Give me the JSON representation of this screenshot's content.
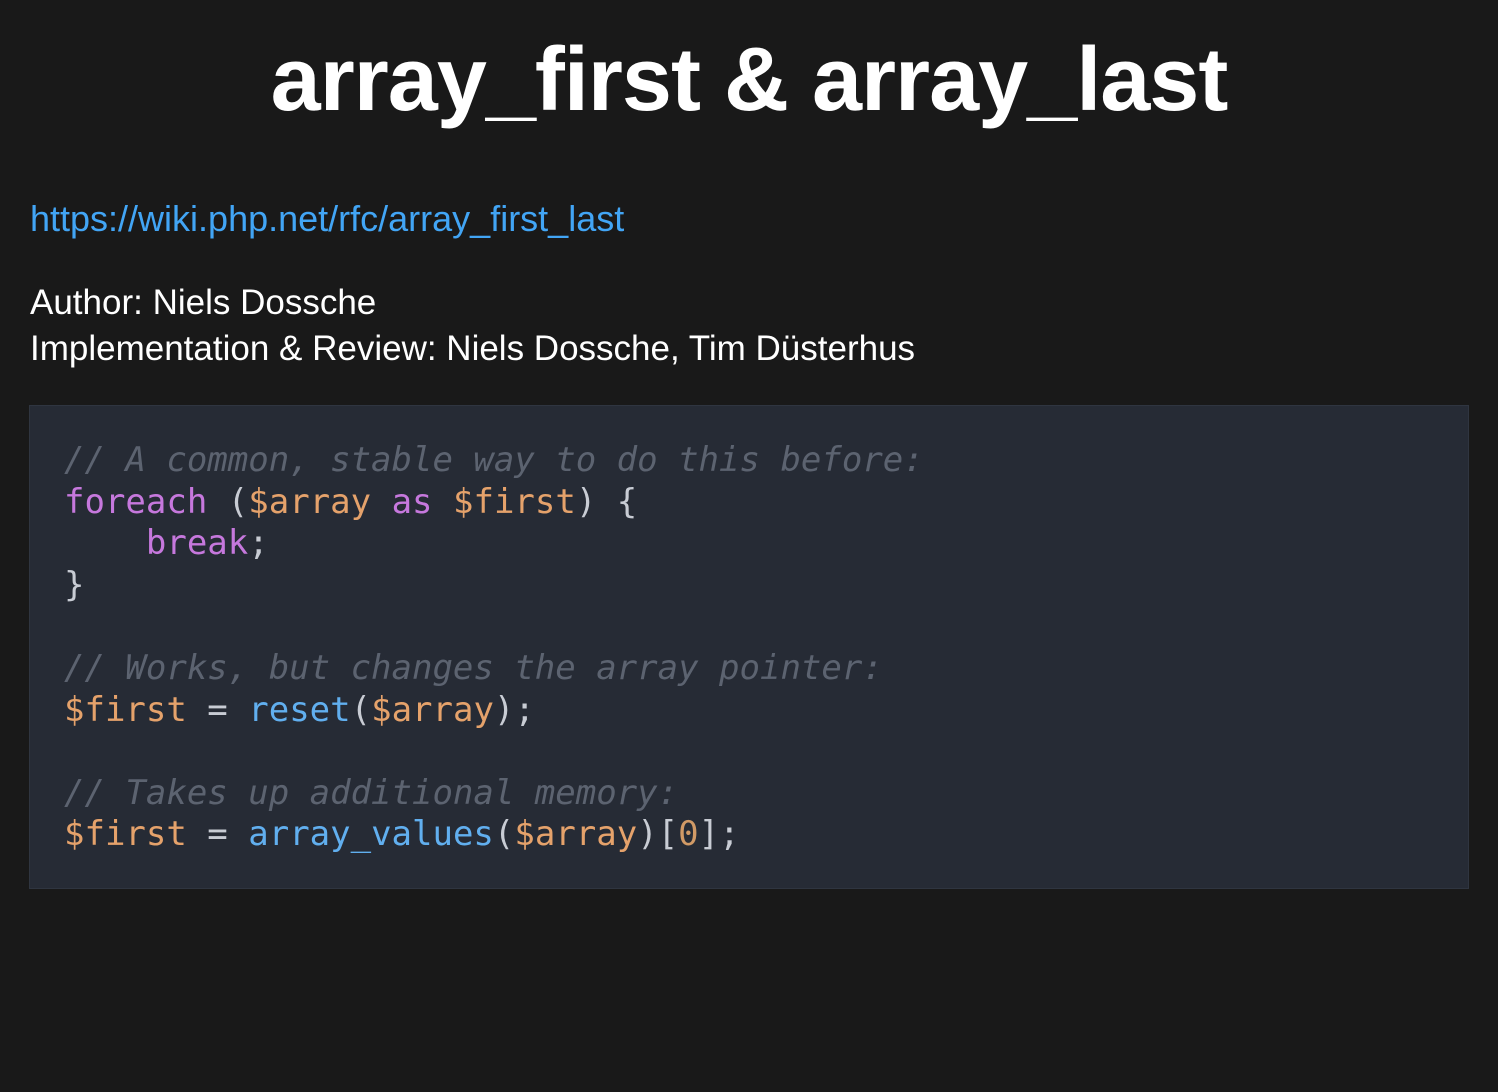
{
  "slide": {
    "title": "array_first & array_last",
    "link": "https://wiki.php.net/rfc/array_first_last",
    "author": "Author: Niels Dossche",
    "implementation": "Implementation & Review: Niels Dossche, Tim Düsterhus"
  },
  "code": {
    "language": "php",
    "colors": {
      "comment": "#5c6370",
      "keyword": "#c678dd",
      "variable": "#e5a26b",
      "function": "#61afef",
      "number": "#d19a66",
      "punctuation": "#c8ccd4",
      "background": "#262b35"
    },
    "lines": [
      [
        {
          "t": "cm",
          "v": "// A common, stable way to do this before:"
        }
      ],
      [
        {
          "t": "kw",
          "v": "foreach"
        },
        {
          "t": "pn",
          "v": " ("
        },
        {
          "t": "var",
          "v": "$array"
        },
        {
          "t": "pn",
          "v": " "
        },
        {
          "t": "kw",
          "v": "as"
        },
        {
          "t": "pn",
          "v": " "
        },
        {
          "t": "var",
          "v": "$first"
        },
        {
          "t": "pn",
          "v": ") {"
        }
      ],
      [
        {
          "t": "pn",
          "v": "    "
        },
        {
          "t": "kw",
          "v": "break"
        },
        {
          "t": "pn",
          "v": ";"
        }
      ],
      [
        {
          "t": "pn",
          "v": "}"
        }
      ],
      [],
      [
        {
          "t": "cm",
          "v": "// Works, but changes the array pointer:"
        }
      ],
      [
        {
          "t": "var",
          "v": "$first"
        },
        {
          "t": "pn",
          "v": " = "
        },
        {
          "t": "fn",
          "v": "reset"
        },
        {
          "t": "pn",
          "v": "("
        },
        {
          "t": "var",
          "v": "$array"
        },
        {
          "t": "pn",
          "v": ");"
        }
      ],
      [],
      [
        {
          "t": "cm",
          "v": "// Takes up additional memory:"
        }
      ],
      [
        {
          "t": "var",
          "v": "$first"
        },
        {
          "t": "pn",
          "v": " = "
        },
        {
          "t": "fn",
          "v": "array_values"
        },
        {
          "t": "pn",
          "v": "("
        },
        {
          "t": "var",
          "v": "$array"
        },
        {
          "t": "pn",
          "v": ")["
        },
        {
          "t": "num",
          "v": "0"
        },
        {
          "t": "pn",
          "v": "];"
        }
      ]
    ]
  }
}
